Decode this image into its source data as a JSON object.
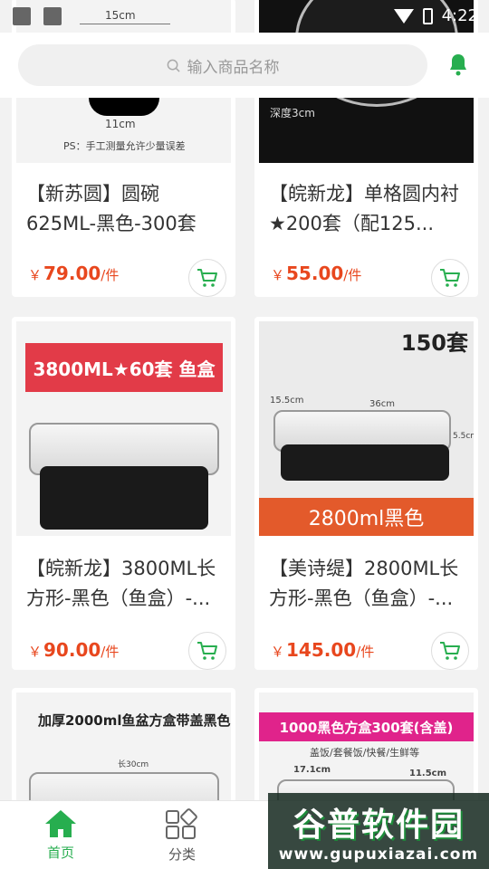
{
  "status_bar": {
    "time": "4:22"
  },
  "search": {
    "placeholder": "输入商品名称"
  },
  "products": [
    {
      "title": "【新苏圆】圆碗625ML-黑色-300套",
      "currency": "￥",
      "price": "79.00",
      "unit": "/件",
      "thumb_text": {
        "top": "15cm",
        "mid": "11cm",
        "note": "PS：手工测量允许少量误差"
      }
    },
    {
      "title": "【皖新龙】单格圆内衬★200套（配125...",
      "currency": "￥",
      "price": "55.00",
      "unit": "/件",
      "thumb_text": {
        "depth": "深度3cm"
      }
    },
    {
      "title": "【皖新龙】3800ML长方形-黑色（鱼盒）-...",
      "currency": "￥",
      "price": "90.00",
      "unit": "/件",
      "thumb_text": {
        "banner": "3800ML★60套 鱼盒"
      }
    },
    {
      "title": "【美诗缇】2800ML长方形-黑色（鱼盒）-...",
      "currency": "￥",
      "price": "145.00",
      "unit": "/件",
      "thumb_text": {
        "corner": "150套",
        "banner": "2800ml黑色",
        "dim1": "15.5cm",
        "dim2": "36cm",
        "dim3": "5.5cm"
      }
    },
    {
      "title": "",
      "currency": "",
      "price": "",
      "unit": "",
      "thumb_text": {
        "banner": "加厚2000ml鱼盆方盒带盖黑色",
        "dim": "长30cm"
      }
    },
    {
      "title": "",
      "currency": "",
      "price": "",
      "unit": "",
      "thumb_text": {
        "banner": "1000黑色方盒300套(含盖)",
        "sub": "盖饭/套餐饭/快餐/生鲜等",
        "dim1": "17.1cm",
        "dim2": "11.5cm"
      }
    }
  ],
  "nav": {
    "home": "首页",
    "category": "分类"
  },
  "watermark": {
    "main": "谷普软件园",
    "url": "www.gupuxiazai.com"
  },
  "colors": {
    "accent": "#27ae4f",
    "price": "#e8471e"
  }
}
